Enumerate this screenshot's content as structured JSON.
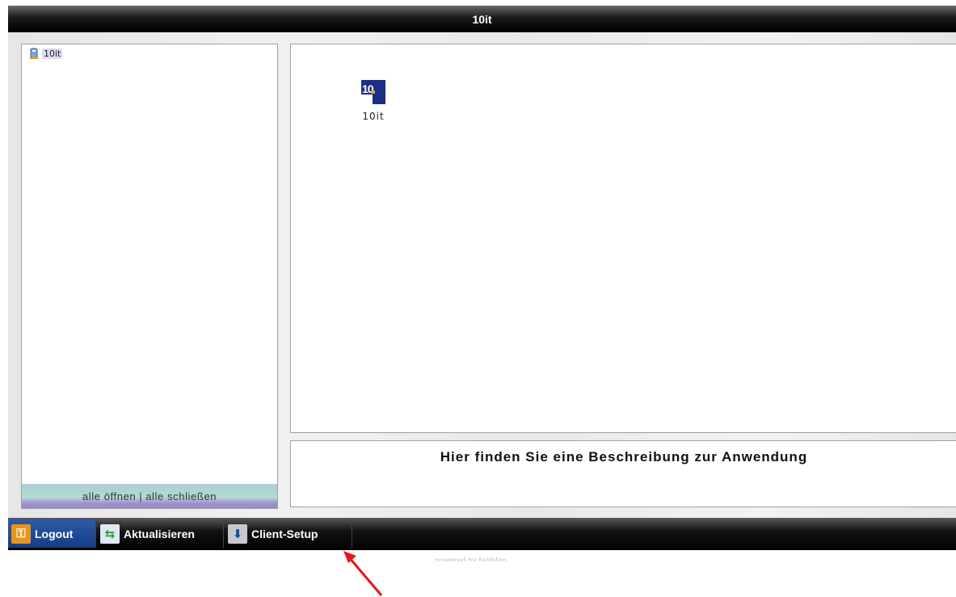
{
  "window": {
    "title": "10it"
  },
  "tree": {
    "root_label": "10it",
    "expand_all": "alle öffnen",
    "separator": "|",
    "collapse_all": "alle schließen"
  },
  "apps": [
    {
      "name": "10it",
      "icon": "10it-logo-icon",
      "icon_text": "10"
    }
  ],
  "description": {
    "text": "Hier finden Sie eine Beschreibung zur Anwendung"
  },
  "taskbar": {
    "logout_label": "Logout",
    "refresh_label": "Aktualisieren",
    "setup_label": "Client-Setup",
    "logout_icon": "key-icon",
    "refresh_icon": "refresh-icon",
    "setup_icon": "client-setup-icon"
  },
  "footer": {
    "powered_by": "powered by NetMan"
  },
  "colors": {
    "titlebar": "#000000",
    "taskbar": "#000000",
    "logout_button": "#1f4c99",
    "annotation_arrow": "#e8141c"
  }
}
